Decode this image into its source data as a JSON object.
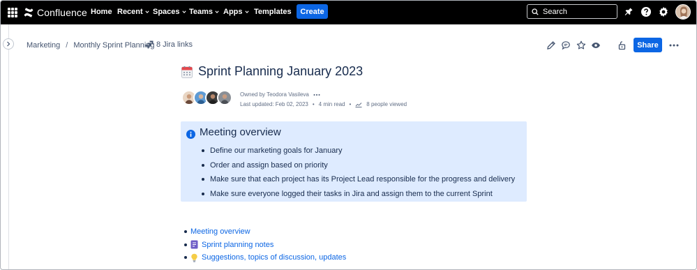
{
  "nav": {
    "logo_text": "Confluence",
    "items": [
      {
        "label": "Home",
        "has_caret": false
      },
      {
        "label": "Recent",
        "has_caret": true
      },
      {
        "label": "Spaces",
        "has_caret": true
      },
      {
        "label": "Teams",
        "has_caret": true
      },
      {
        "label": "Apps",
        "has_caret": true
      },
      {
        "label": "Templates",
        "has_caret": false
      }
    ],
    "create_label": "Create",
    "search_placeholder": "Search"
  },
  "breadcrumb": {
    "items": [
      "Marketing",
      "Monthly Sprint Planning"
    ],
    "separator": "/",
    "jira_links": "8 Jira links"
  },
  "toolbar": {
    "share_label": "Share"
  },
  "page": {
    "title": "Sprint Planning January 2023",
    "owned_by": "Owned by Teodora Vasileva",
    "last_updated": "Last updated: Feb 02, 2023",
    "read_time": "4 min read",
    "viewed": "8 people viewed"
  },
  "panel": {
    "title": "Meeting overview",
    "items": [
      "Define our marketing goals for January",
      "Order and assign based on priority",
      "Make sure that each project has its Project Lead responsible for the progress and delivery",
      "Make sure everyone logged their tasks in Jira and assign them to the current Sprint"
    ]
  },
  "toc": {
    "items": [
      {
        "label": "Meeting overview",
        "icon": "none"
      },
      {
        "label": "Sprint planning notes",
        "icon": "notes-icon"
      },
      {
        "label": "Suggestions, topics of discussion, updates",
        "icon": "lightbulb-icon"
      }
    ]
  },
  "colors": {
    "nav_bg": "#000000",
    "accent": "#0c66e4",
    "panel_bg": "#deebff",
    "text": "#172b4d"
  }
}
